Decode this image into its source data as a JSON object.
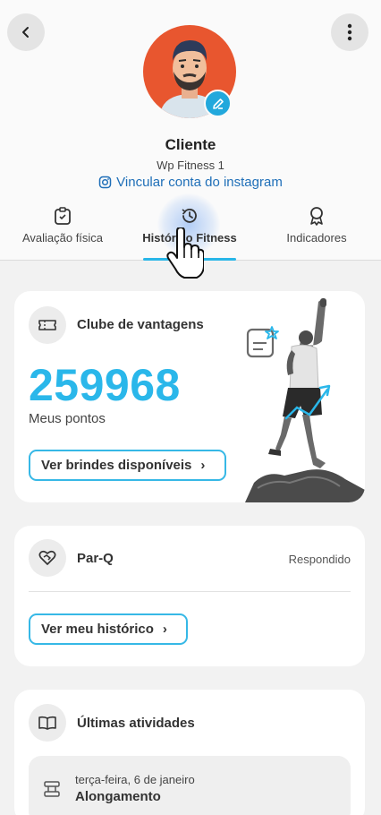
{
  "profile": {
    "name": "Cliente",
    "company": "Wp Fitness 1",
    "instagram_link": "Vincular conta do instagram"
  },
  "tabs": [
    {
      "label": "Avaliação física",
      "icon": "clipboard-icon",
      "active": false
    },
    {
      "label": "Histórico Fitness",
      "icon": "history-icon",
      "active": true
    },
    {
      "label": "Indicadores",
      "icon": "badge-icon",
      "active": false
    }
  ],
  "benefits_card": {
    "title": "Clube de vantagens",
    "icon": "ticket-icon",
    "points": "259968",
    "points_label": "Meus pontos",
    "button_label": "Ver brindes disponíveis",
    "button_arrow": "›"
  },
  "parq_card": {
    "title": "Par-Q",
    "icon": "heart-handshake-icon",
    "status": "Respondido",
    "button_label": "Ver meu histórico",
    "button_arrow": "›"
  },
  "activities_card": {
    "title": "Últimas atividades",
    "icon": "book-icon",
    "items": [
      {
        "date": "terça-feira, 6 de janeiro",
        "name": "Alongamento",
        "icon": "exercise-icon"
      }
    ]
  },
  "colors": {
    "accent": "#29b6e8",
    "link": "#1f6fb8",
    "avatar_bg": "#e8562f",
    "points": "#2ab7ea"
  }
}
